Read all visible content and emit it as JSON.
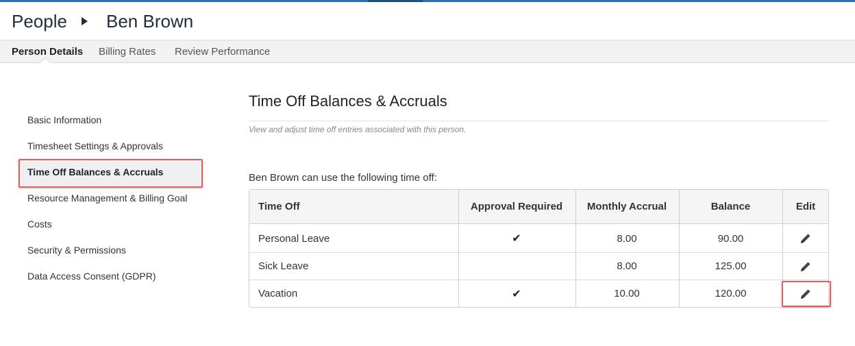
{
  "header": {
    "breadcrumb_root": "People",
    "breadcrumb_person": "Ben Brown"
  },
  "tabs": [
    {
      "label": "Person Details",
      "active": true
    },
    {
      "label": "Billing Rates",
      "active": false
    },
    {
      "label": "Review Performance",
      "active": false
    }
  ],
  "sidebar": {
    "items": [
      {
        "label": "Basic Information"
      },
      {
        "label": "Timesheet Settings & Approvals"
      },
      {
        "label": "Time Off Balances & Accruals",
        "active": true
      },
      {
        "label": "Resource Management & Billing Goal"
      },
      {
        "label": "Costs"
      },
      {
        "label": "Security & Permissions"
      },
      {
        "label": "Data Access Consent (GDPR)"
      }
    ]
  },
  "main": {
    "title": "Time Off Balances & Accruals",
    "description": "View and adjust time off entries associated with this person.",
    "intro": "Ben Brown can use the following time off:",
    "table": {
      "columns": [
        "Time Off",
        "Approval Required",
        "Monthly Accrual",
        "Balance",
        "Edit"
      ],
      "rows": [
        {
          "name": "Personal Leave",
          "approval_required": true,
          "monthly_accrual": "8.00",
          "balance": "90.00"
        },
        {
          "name": "Sick Leave",
          "approval_required": false,
          "monthly_accrual": "8.00",
          "balance": "125.00"
        },
        {
          "name": "Vacation",
          "approval_required": true,
          "monthly_accrual": "10.00",
          "balance": "120.00"
        }
      ]
    }
  },
  "icons": {
    "check": "checkmark-icon",
    "edit": "pencil-icon",
    "breadcrumb_separator": "triangle-right-icon"
  },
  "colors": {
    "accent_bar": "#2a6ebb",
    "highlight_border": "#e0605a"
  }
}
